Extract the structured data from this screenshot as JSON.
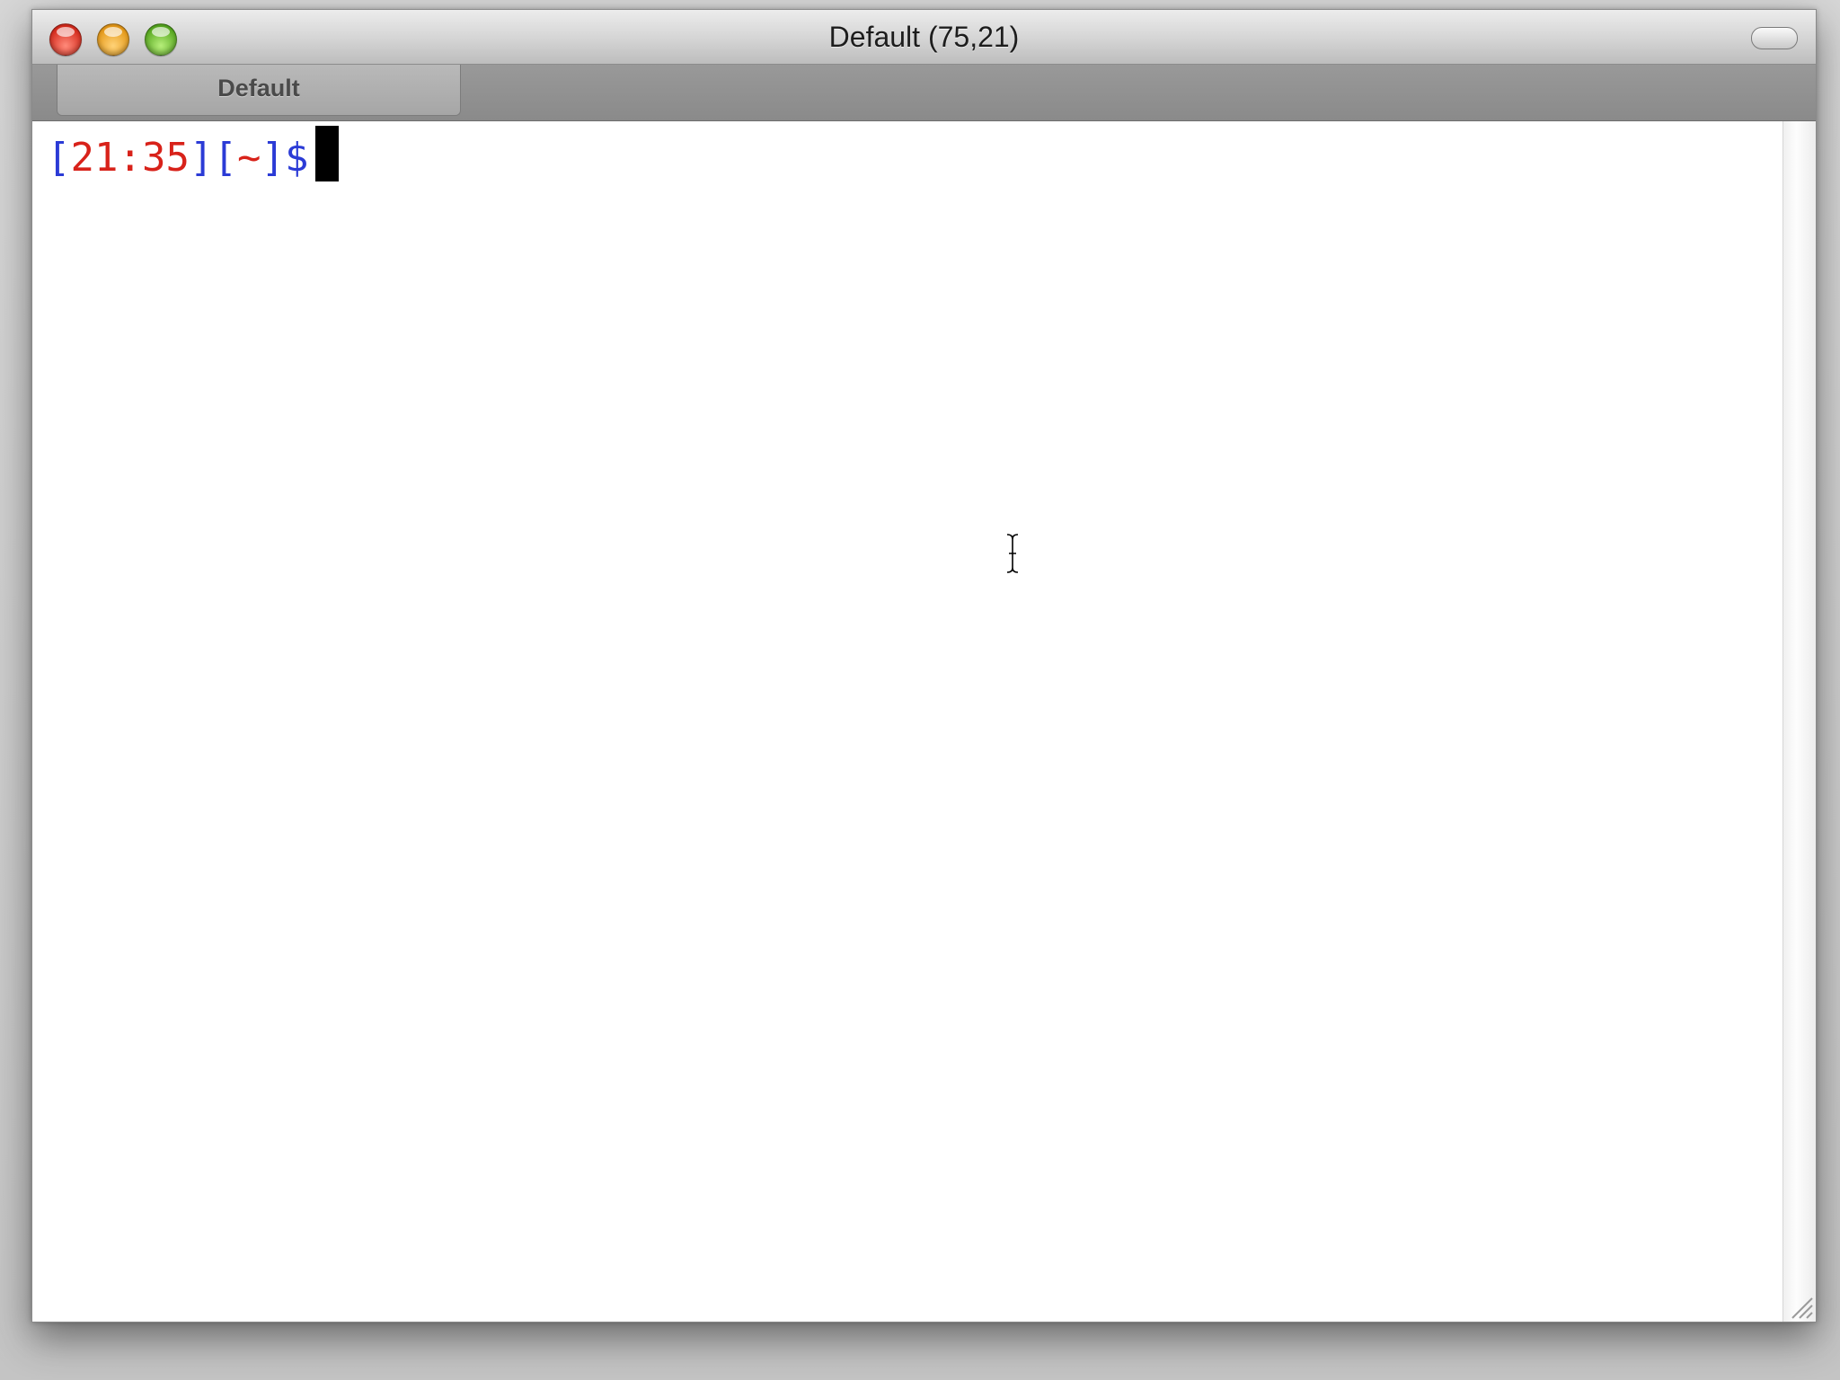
{
  "window": {
    "title": "Default (75,21)"
  },
  "tabs": [
    {
      "label": "Default",
      "active": true
    }
  ],
  "terminal": {
    "prompt": {
      "open_bracket_1": "[",
      "time": "21:35",
      "close_bracket_1": "]",
      "open_bracket_2": "[",
      "cwd": "~",
      "close_bracket_2": "]",
      "symbol": "$"
    }
  },
  "colors": {
    "bracket": "#2b3bd6",
    "time": "#d8221a",
    "cwd": "#d8221a",
    "symbol": "#2b3bd6"
  },
  "icons": {
    "close": "close-icon",
    "minimize": "minimize-icon",
    "zoom": "zoom-icon",
    "toolbar_toggle": "toolbar-toggle-icon",
    "resize": "resize-grip-icon",
    "mouse_cursor": "ibeam-cursor-icon"
  }
}
